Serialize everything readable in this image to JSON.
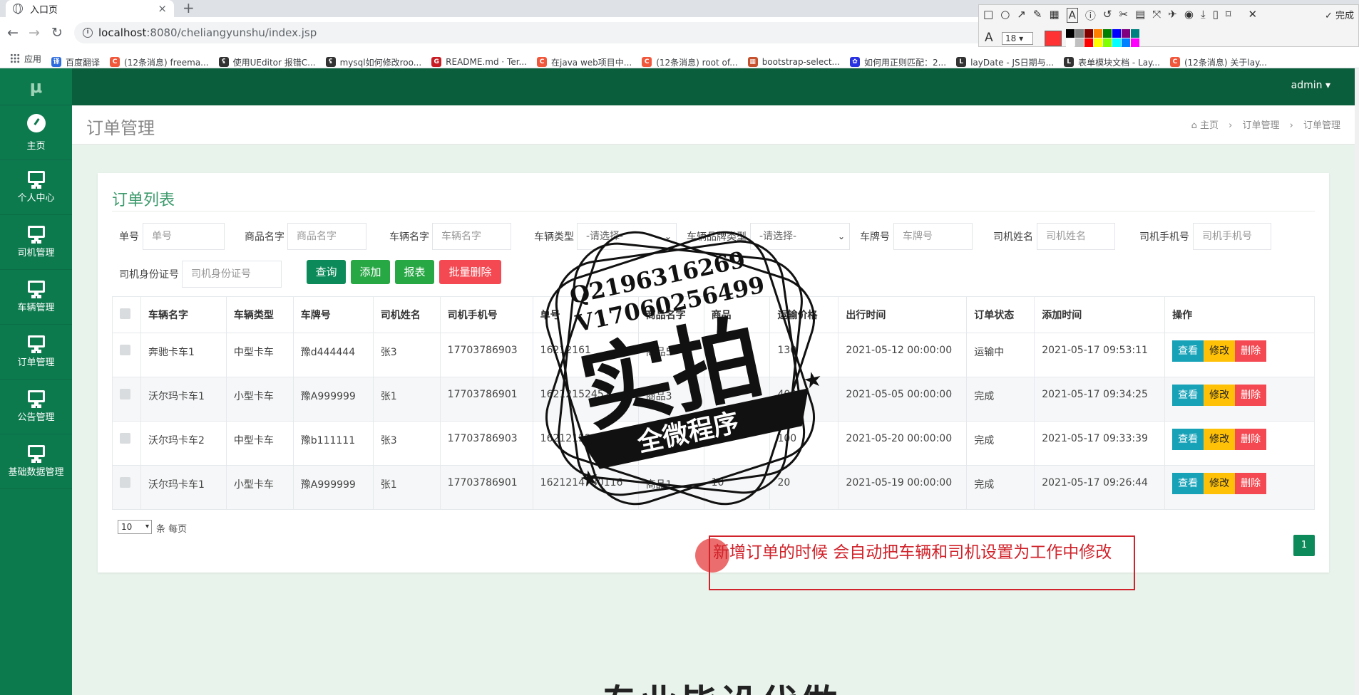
{
  "browser": {
    "tab_title": "入口页",
    "tab_close": "×",
    "new_tab": "+",
    "url_host": "localhost",
    "url_rest": ":8080/cheliangyunshu/index.jsp",
    "bookmarks": [
      {
        "label": "应用",
        "icon": "apps-icon"
      },
      {
        "label": "百度翻译",
        "color": "#2d6cdf",
        "glyph": "译"
      },
      {
        "label": "(12条消息) freema...",
        "color": "#f1573b",
        "glyph": "C"
      },
      {
        "label": "使用UEditor 报错C...",
        "color": "#333333",
        "glyph": "ʢ"
      },
      {
        "label": "mysql如何修改roo...",
        "color": "#333333",
        "glyph": "ʢ"
      },
      {
        "label": "README.md · Ter...",
        "color": "#c71d23",
        "glyph": "G"
      },
      {
        "label": "在java web项目中...",
        "color": "#f1573b",
        "glyph": "C"
      },
      {
        "label": "(12条消息) root of...",
        "color": "#f1573b",
        "glyph": "C"
      },
      {
        "label": "bootstrap-select...",
        "color": "#c5512f",
        "glyph": "▦"
      },
      {
        "label": "如何用正则匹配：2...",
        "color": "#2932e1",
        "glyph": "✿"
      },
      {
        "label": "layDate - JS日期与...",
        "color": "#333333",
        "glyph": "L"
      },
      {
        "label": "表单模块文档 - Lay...",
        "color": "#333333",
        "glyph": "L"
      },
      {
        "label": "(12条消息) 关于lay...",
        "color": "#f1573b",
        "glyph": "C"
      }
    ],
    "shot_toolbar": {
      "done_label": "完成",
      "font_size": "18",
      "current_color": "#ff3333",
      "palette": [
        "#000000",
        "#808080",
        "#800000",
        "#ff8000",
        "#008000",
        "#0000ff",
        "#800080",
        "#008080",
        "#ffffff",
        "#c0c0c0",
        "#ff0000",
        "#ffff00",
        "#80ff00",
        "#00ffff",
        "#0080ff",
        "#ff00ff"
      ]
    }
  },
  "app": {
    "logo": "μ",
    "user": "admin",
    "sidebar": [
      {
        "label": "主页",
        "icon": "dashboard-icon"
      },
      {
        "label": "个人中心",
        "icon": "monitor-icon"
      },
      {
        "label": "司机管理",
        "icon": "monitor-icon"
      },
      {
        "label": "车辆管理",
        "icon": "monitor-icon"
      },
      {
        "label": "订单管理",
        "icon": "monitor-icon"
      },
      {
        "label": "公告管理",
        "icon": "monitor-icon"
      },
      {
        "label": "基础数据管理",
        "icon": "monitor-icon"
      }
    ],
    "page_title": "订单管理",
    "breadcrumb": [
      "主页",
      "订单管理",
      "订单管理"
    ],
    "panel_title": "订单列表",
    "filters": {
      "order_no": {
        "label": "单号",
        "placeholder": "单号"
      },
      "goods_name": {
        "label": "商品名字",
        "placeholder": "商品名字"
      },
      "vehicle_name": {
        "label": "车辆名字",
        "placeholder": "车辆名字"
      },
      "vehicle_type": {
        "label": "车辆类型",
        "value": "-请选择-"
      },
      "brand_type": {
        "label": "车辆品牌类型",
        "value": "-请选择-"
      },
      "plate": {
        "label": "车牌号",
        "placeholder": "车牌号"
      },
      "driver_name": {
        "label": "司机姓名",
        "placeholder": "司机姓名"
      },
      "driver_phone": {
        "label": "司机手机号",
        "placeholder": "司机手机号"
      },
      "driver_id": {
        "label": "司机身份证号",
        "placeholder": "司机身份证号"
      }
    },
    "buttons": {
      "query": "查询",
      "add": "添加",
      "report": "报表",
      "batch_delete": "批量删除"
    },
    "table": {
      "headers": [
        "车辆名字",
        "车辆类型",
        "车牌号",
        "司机姓名",
        "司机手机号",
        "单号",
        "商品名字",
        "商品",
        "运输价格",
        "出行时间",
        "订单状态",
        "添加时间",
        "操作"
      ],
      "rows": [
        [
          "奔驰卡车1",
          "中型卡车",
          "豫d444444",
          "张3",
          "17703786903",
          "16212161",
          "商品5",
          "",
          "130",
          "2021-05-12 00:00:00",
          "运输中",
          "2021-05-17 09:53:11"
        ],
        [
          "沃尔玛卡车1",
          "小型卡车",
          "豫A999999",
          "张1",
          "17703786901",
          "16212152457",
          "商品3",
          "",
          "400",
          "2021-05-05 00:00:00",
          "完成",
          "2021-05-17 09:34:25"
        ],
        [
          "沃尔玛卡车2",
          "中型卡车",
          "豫b111111",
          "张3",
          "17703786903",
          "1621215200229",
          "",
          "",
          "100",
          "2021-05-20 00:00:00",
          "完成",
          "2021-05-17 09:33:39"
        ],
        [
          "沃尔玛卡车1",
          "小型卡车",
          "豫A999999",
          "张1",
          "17703786901",
          "1621214780116",
          "商品1",
          "10",
          "20",
          "2021-05-19 00:00:00",
          "完成",
          "2021-05-17 09:26:44"
        ]
      ],
      "ops": {
        "view": "查看",
        "edit": "修改",
        "delete": "删除"
      }
    },
    "pager": {
      "page_size": "10",
      "suffix": "条 每页",
      "current_page": "1"
    }
  },
  "overlay": {
    "annotation": "新增订单的时候 会自动把车辆和司机设置为工作中修改",
    "stamp": {
      "line1": "Q2196316269",
      "line2": "V17060256499",
      "big": "实拍",
      "band": "全微程序"
    },
    "bottom_text": "专业毕设代做"
  }
}
